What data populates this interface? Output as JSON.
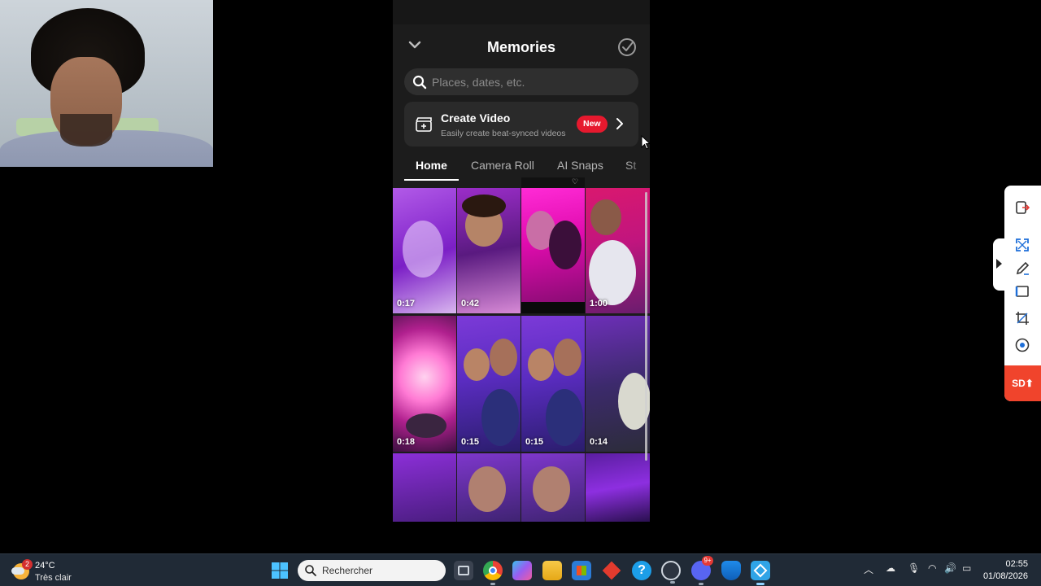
{
  "phone": {
    "title": "Memories",
    "search_placeholder": "Places, dates, etc.",
    "create_video": {
      "title": "Create Video",
      "subtitle": "Easily create beat-synced videos",
      "badge": "New"
    },
    "tabs": [
      "Home",
      "Camera Roll",
      "AI Snaps",
      "St"
    ],
    "tiles": [
      {
        "duration": "0:17"
      },
      {
        "duration": "0:42"
      },
      {
        "duration": ""
      },
      {
        "duration": "1:00"
      },
      {
        "duration": "0:18"
      },
      {
        "duration": "0:15"
      },
      {
        "duration": "0:15"
      },
      {
        "duration": "0:14"
      },
      {
        "duration": ""
      },
      {
        "duration": ""
      },
      {
        "duration": ""
      },
      {
        "duration": ""
      }
    ]
  },
  "side_toolbar": {
    "badge": "SD"
  },
  "taskbar": {
    "weather_badge": "2",
    "temperature": "24°C",
    "condition": "Très clair",
    "search_label": "Rechercher",
    "discord_badge": "9+",
    "time": "02:55",
    "date": "01/08/2026"
  },
  "colors": {
    "accent_red": "#e6192e",
    "tile_magenta": "#c213b8",
    "tile_purple": "#7a2fd0"
  }
}
